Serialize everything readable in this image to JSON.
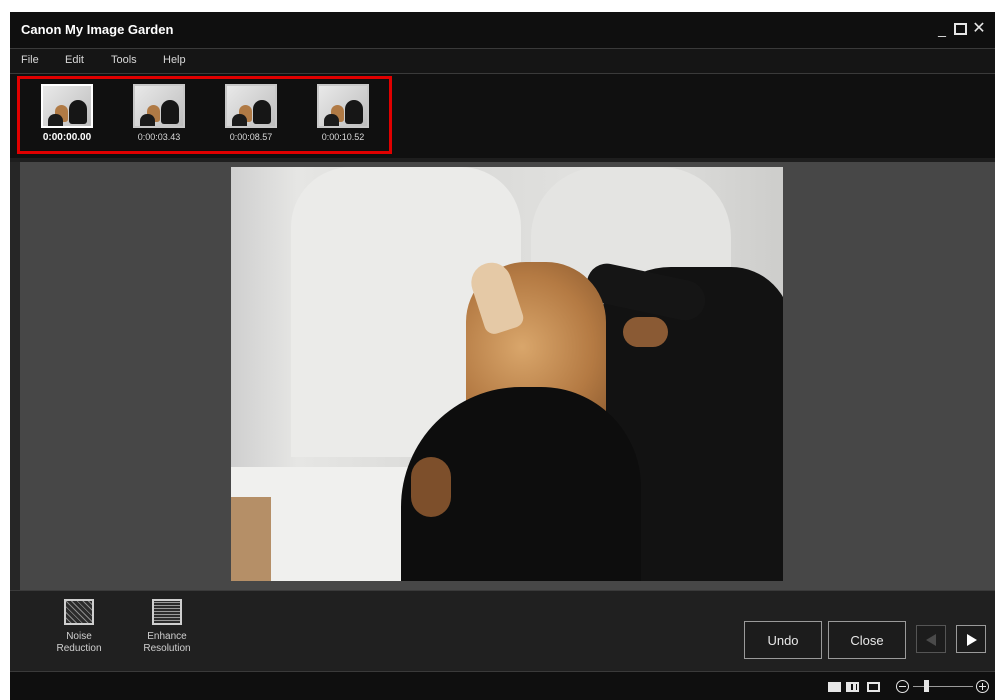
{
  "window": {
    "title": "Canon My Image Garden",
    "controls": {
      "minimize": "_",
      "close": "✕"
    }
  },
  "menu": {
    "items": [
      {
        "label": "File"
      },
      {
        "label": "Edit"
      },
      {
        "label": "Tools"
      },
      {
        "label": "Help"
      }
    ]
  },
  "filmstrip": {
    "frames": [
      {
        "timecode": "0:00:00.00",
        "selected": true
      },
      {
        "timecode": "0:00:03.43",
        "selected": false
      },
      {
        "timecode": "0:00:08.57",
        "selected": false
      },
      {
        "timecode": "0:00:10.52",
        "selected": false
      }
    ],
    "highlight_color": "#e00000"
  },
  "preview": {
    "subject": "photo-dogs"
  },
  "tools": [
    {
      "label_line1": "Noise",
      "label_line2": "Reduction",
      "icon": "noise-reduction-icon"
    },
    {
      "label_line1": "Enhance",
      "label_line2": "Resolution",
      "icon": "enhance-resolution-icon"
    }
  ],
  "buttons": {
    "undo": "Undo",
    "close": "Close"
  },
  "statusbar": {
    "view_icons": [
      "single-view-icon",
      "double-view-icon",
      "full-screen-icon"
    ],
    "zoom_level": 0.22
  },
  "colors": {
    "window_bg": "#1e1e1e",
    "preview_bg": "#474747",
    "highlight": "#e00000"
  }
}
